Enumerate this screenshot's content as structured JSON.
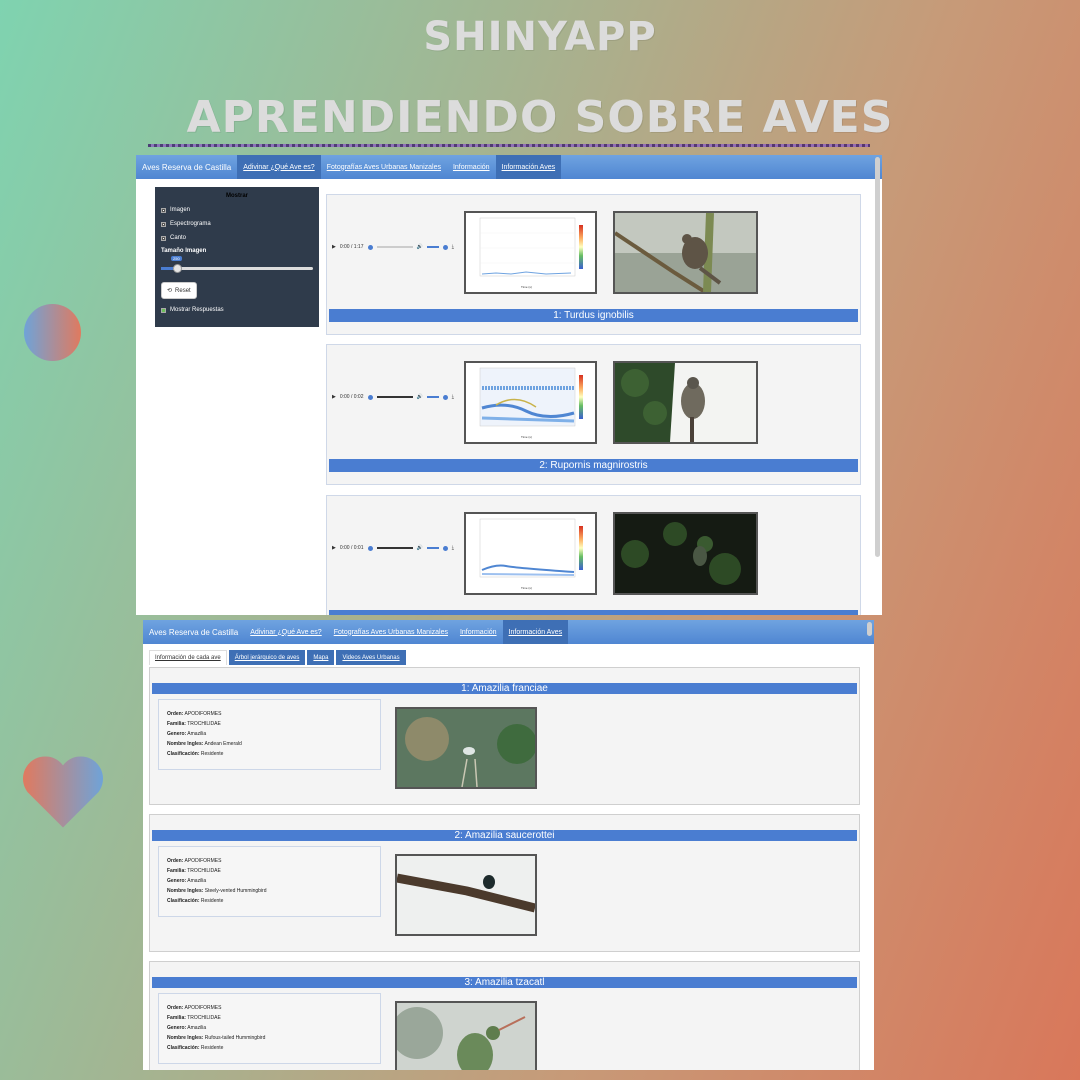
{
  "headline": {
    "line1": "SHINYAPP",
    "line2": "APRENDIENDO SOBRE AVES"
  },
  "app": {
    "brand": "Aves Reserva de Castilla",
    "tabs": [
      "Adivinar ¿Qué Ave es?",
      "Fotografías Aves Urbanas Manizales",
      "Información",
      "Información Aves"
    ]
  },
  "sidebar": {
    "title": "Mostrar",
    "options": [
      "Imagen",
      "Espectrograma",
      "Canto"
    ],
    "size_label": "Tamaño Imagen",
    "slider_value": "250",
    "reset_label": "Reset",
    "show_answers": "Mostrar Respuestas"
  },
  "bird_cards": [
    {
      "title": "1: Turdus ignobilis",
      "time": "0:00 / 1:17"
    },
    {
      "title": "2: Rupornis magnirostris",
      "time": "0:00 / 0:02"
    },
    {
      "title": "",
      "time": "0:00 / 0:01"
    }
  ],
  "spectrogram": {
    "xlabel": "Time (s)",
    "ylabel": "Frequency (kHz)"
  },
  "info_tabs": [
    "Información de cada ave",
    "Árbol jerárquico de aves",
    "Mapa",
    "Videos Aves Urbanas"
  ],
  "info_labels": {
    "orden": "Orden:",
    "familia": "Familia:",
    "genero": "Genero:",
    "nombre_ingles": "Nombre Ingles:",
    "clasificacion": "Clasificación:"
  },
  "info_cards": [
    {
      "title": "1: Amazilia franciae",
      "orden": "APODIFORMES",
      "familia": "TROCHILIDAE",
      "genero": "Amazilia",
      "nombre_ingles": "Andean Emerald",
      "clasificacion": "Residente"
    },
    {
      "title": "2: Amazilia saucerottei",
      "orden": "APODIFORMES",
      "familia": "TROCHILIDAE",
      "genero": "Amazilia",
      "nombre_ingles": "Steely-vented Hummingbird",
      "clasificacion": "Residente"
    },
    {
      "title": "3: Amazilia tzacatl",
      "orden": "APODIFORMES",
      "familia": "TROCHILIDAE",
      "genero": "Amazilia",
      "nombre_ingles": "Rufous-tailed Hummingbird",
      "clasificacion": "Residente"
    }
  ],
  "colors": {
    "accent": "#4a7dd1",
    "navbar": "#5b93da",
    "sidebar": "#2f3b4b"
  }
}
